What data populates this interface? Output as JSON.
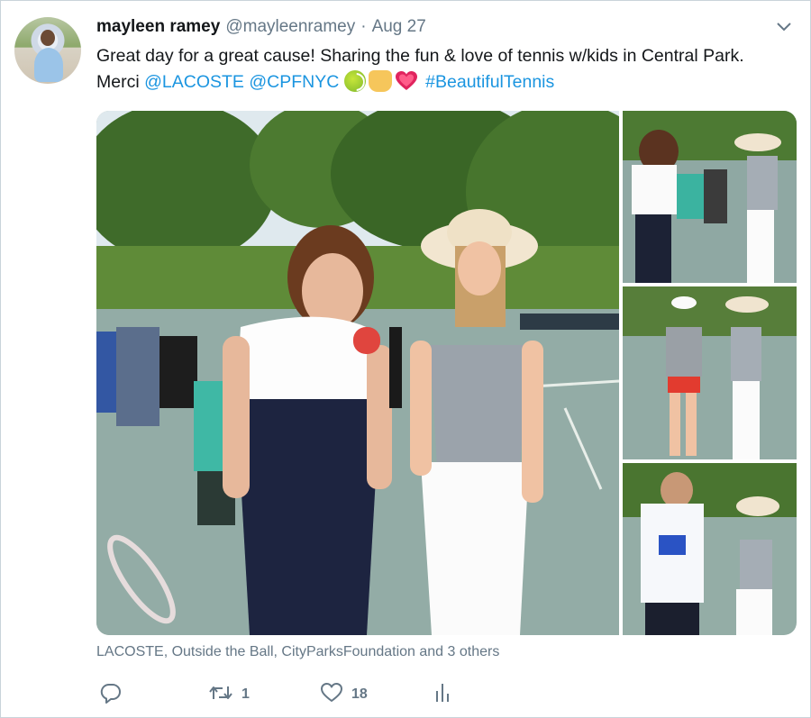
{
  "user": {
    "name": "mayleen ramey",
    "handle": "@mayleenramey",
    "separator": "·",
    "date": "Aug 27"
  },
  "tweet": {
    "text_part1": "Great day for a great cause! Sharing the fun & love of tennis w/kids in Central Park. Merci ",
    "mention1": "@LACOSTE",
    "space": " ",
    "mention2": "@CPFNYC",
    "emojis": [
      "tennis-ball",
      "raising-hands",
      "growing-heart"
    ],
    "hashtag": "#BeautifulTennis"
  },
  "media": {
    "photo_count": 4
  },
  "tagged": "LACOSTE, Outside the Ball, CityParksFoundation and 3 others",
  "actions": {
    "reply_count": "",
    "retweet_count": "1",
    "like_count": "18"
  },
  "icons": {
    "menu": "chevron-down-icon",
    "reply": "reply-icon",
    "retweet": "retweet-icon",
    "like": "heart-icon",
    "stats": "analytics-icon"
  },
  "colors": {
    "link": "#1b95e0",
    "secondary_text": "#657786",
    "primary_text": "#14171a",
    "border": "#c9d3da"
  }
}
